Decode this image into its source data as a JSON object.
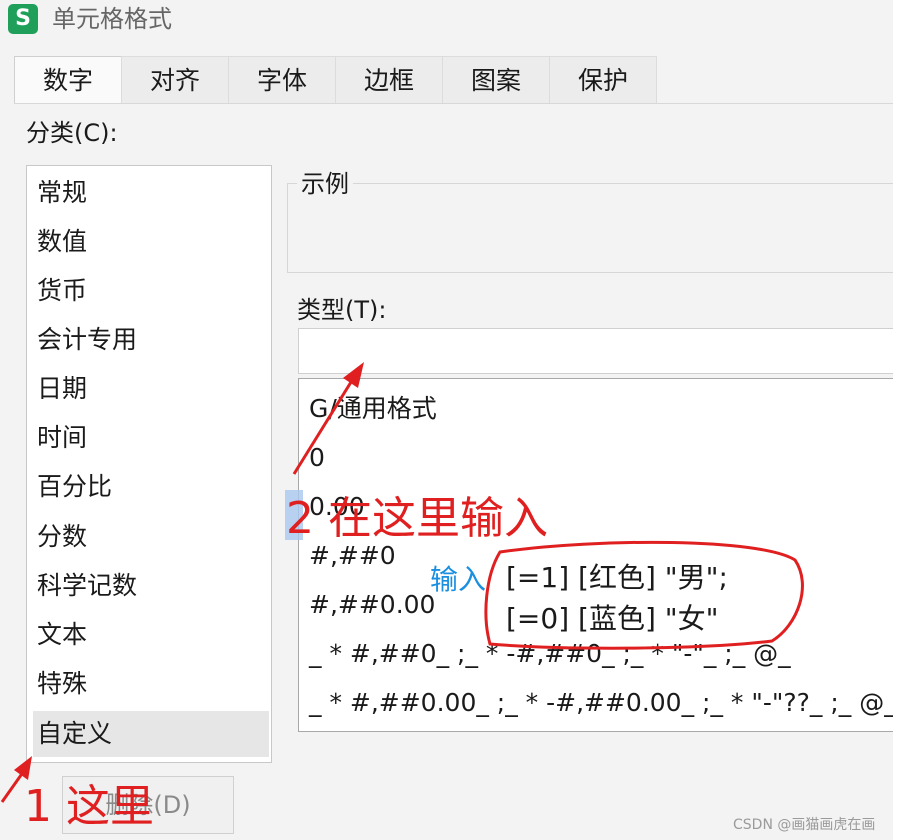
{
  "window": {
    "app_icon_letter": "S",
    "title": "单元格格式"
  },
  "tabs": [
    {
      "label": "数字",
      "active": true
    },
    {
      "label": "对齐",
      "active": false
    },
    {
      "label": "字体",
      "active": false
    },
    {
      "label": "边框",
      "active": false
    },
    {
      "label": "图案",
      "active": false
    },
    {
      "label": "保护",
      "active": false
    }
  ],
  "category": {
    "label": "分类(C):",
    "items": [
      "常规",
      "数值",
      "货币",
      "会计专用",
      "日期",
      "时间",
      "百分比",
      "分数",
      "科学记数",
      "文本",
      "特殊",
      "自定义"
    ],
    "selected": "自定义"
  },
  "sample": {
    "label": "示例"
  },
  "type": {
    "label": "类型(T):",
    "value": "",
    "formats": [
      "G/通用格式",
      "0",
      "0.00",
      "#,##0",
      "#,##0.00",
      "_ * #,##0_ ;_ * -#,##0_ ;_ * \"-\"_ ;_ @_",
      "_ * #,##0.00_ ;_ * -#,##0.00_ ;_ * \"-\"??_ ;_ @_"
    ]
  },
  "buttons": {
    "delete_label": "删除(D)"
  },
  "annotations": {
    "step1": "1 这里",
    "step2": "2 在这里输入",
    "input_hint": "输入",
    "code_line1": "[=1]  [红色] \"男\";",
    "code_line2": "[=0]  [蓝色] \"女\"",
    "red_color": "#e02020",
    "blue_color": "#1a8fe0"
  },
  "watermark": "CSDN @画猫画虎在画"
}
